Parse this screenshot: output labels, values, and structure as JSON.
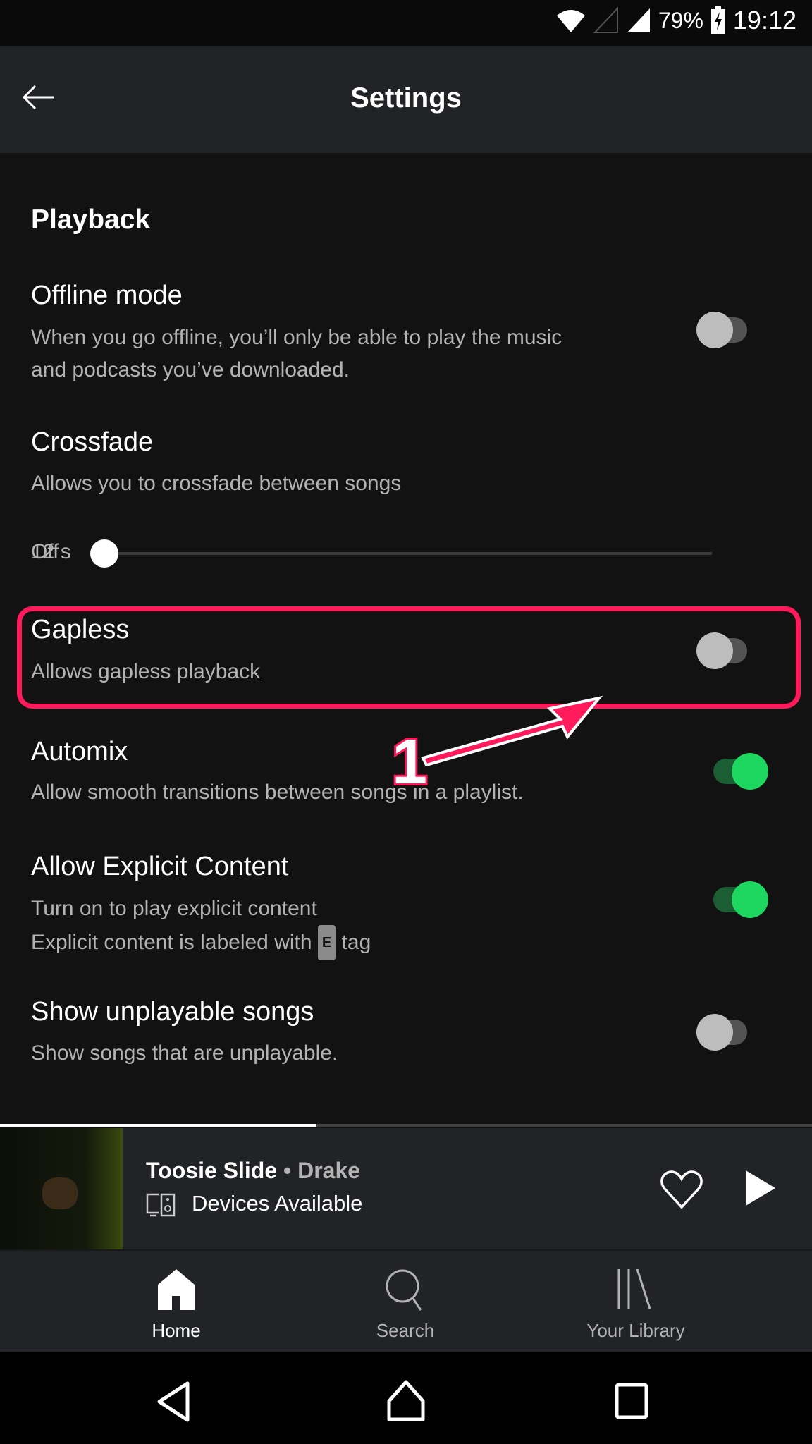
{
  "status_bar": {
    "battery": "79%",
    "time": "19:12",
    "icons": [
      "wifi-icon",
      "no-sim-signal-icon",
      "cell-signal-icon",
      "battery-charging-icon"
    ]
  },
  "header": {
    "title": "Settings",
    "back_icon": "arrow-left-icon"
  },
  "section": "Playback",
  "settings": [
    {
      "title": "Offline mode",
      "desc": [
        "When you go offline, you’ll only be able to play the music",
        "and podcasts you’ve downloaded."
      ],
      "on": false
    },
    {
      "title": "Crossfade",
      "desc": [
        "Allows you to crossfade between songs"
      ]
    },
    {
      "title": "Gapless",
      "desc": [
        "Allows gapless playback"
      ],
      "on": false
    },
    {
      "title": "Automix",
      "desc": [
        "Allow smooth transitions between songs in a playlist."
      ],
      "on": true
    },
    {
      "title": "Allow Explicit Content",
      "desc": [
        "Turn on to play explicit content",
        "Explicit content is labeled with"
      ],
      "tag": "E",
      "tag_suffix": "tag",
      "on": true
    },
    {
      "title": "Show unplayable songs",
      "desc": [
        "Show songs that are unplayable."
      ],
      "on": false
    }
  ],
  "crossfade_slider": {
    "min_label": "Off",
    "max_label": "12 s",
    "value_seconds": 0
  },
  "annotation": {
    "number": "1",
    "color": "#ff1a5c"
  },
  "mini_player": {
    "track": "Toosie Slide",
    "separator": "•",
    "artist": "Drake",
    "devices": "Devices Available",
    "progress_percent": 39
  },
  "bottom_nav": [
    {
      "label": "Home",
      "icon": "home-icon",
      "active": true
    },
    {
      "label": "Search",
      "icon": "search-icon"
    },
    {
      "label": "Your Library",
      "icon": "library-icon"
    }
  ],
  "colors": {
    "accent": "#1ed760",
    "background": "#121212",
    "header": "#222326"
  }
}
